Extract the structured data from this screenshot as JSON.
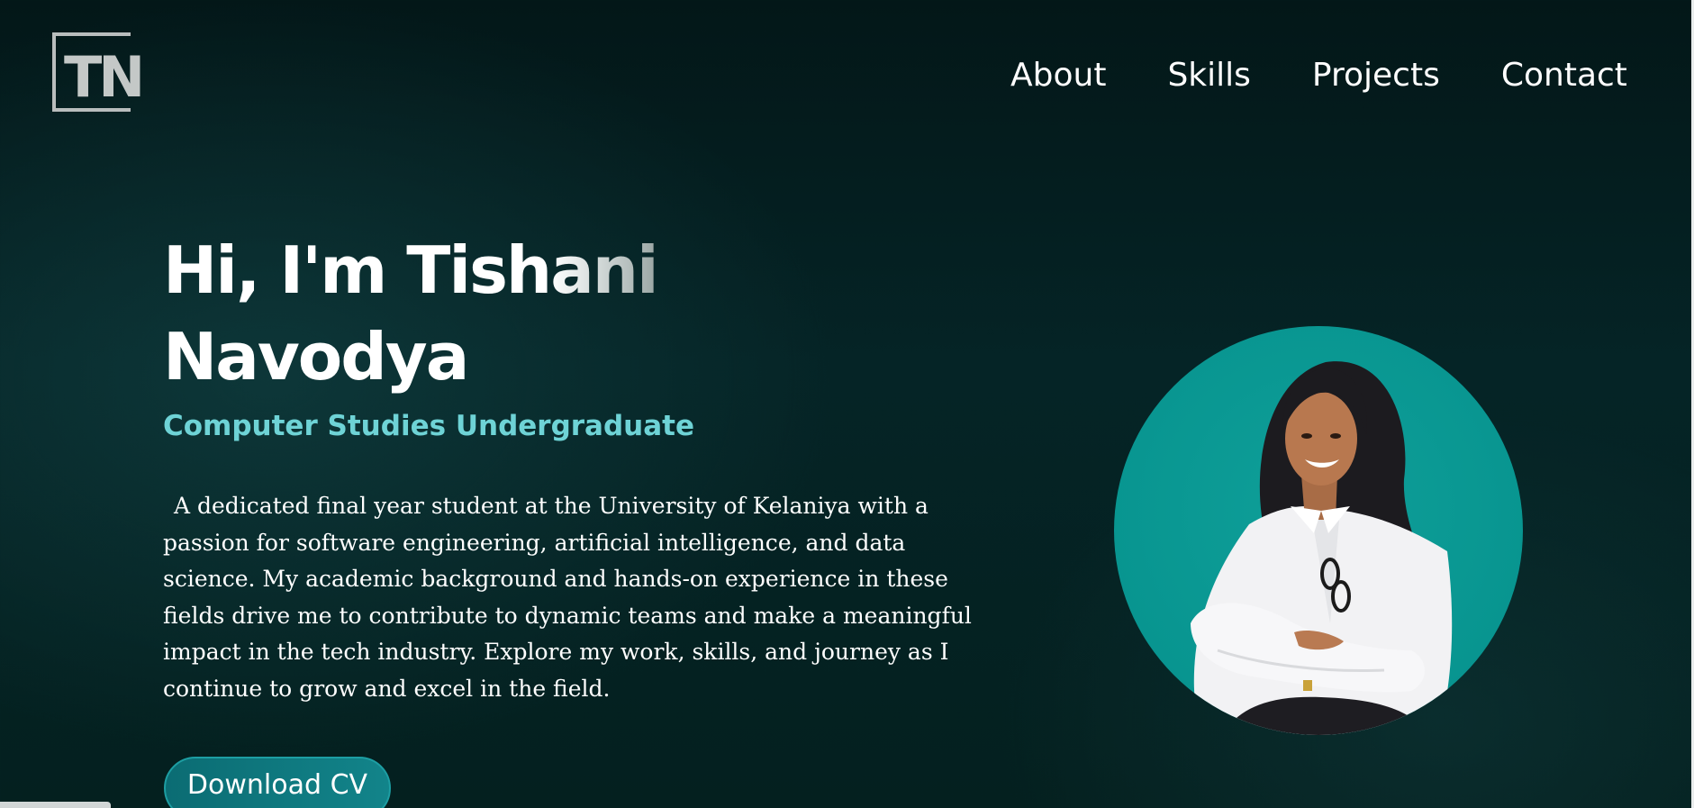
{
  "logo": {
    "text": "TN",
    "icon": "tn-monogram-logo"
  },
  "nav": {
    "items": [
      {
        "label": "About"
      },
      {
        "label": "Skills"
      },
      {
        "label": "Projects"
      },
      {
        "label": "Contact"
      }
    ]
  },
  "hero": {
    "greeting_start": "Hi, I'm Tish",
    "greeting_fade": "ani",
    "surname": "Navodya",
    "subtitle": "Computer Studies Undergraduate",
    "bio": "A dedicated final year student at the University of Kelaniya with a passion for software engineering, artificial intelligence, and data science. My academic background and hands-on experience in these fields drive me to contribute to dynamic teams and make a meaningful impact in the tech industry. Explore my work, skills, and journey as I continue to grow and excel in the field.",
    "cta_label": "Download CV"
  },
  "colors": {
    "background": "#04201f",
    "accent": "#6ed3d6",
    "button": "#0b6c73",
    "portrait_circle": "#089590"
  }
}
